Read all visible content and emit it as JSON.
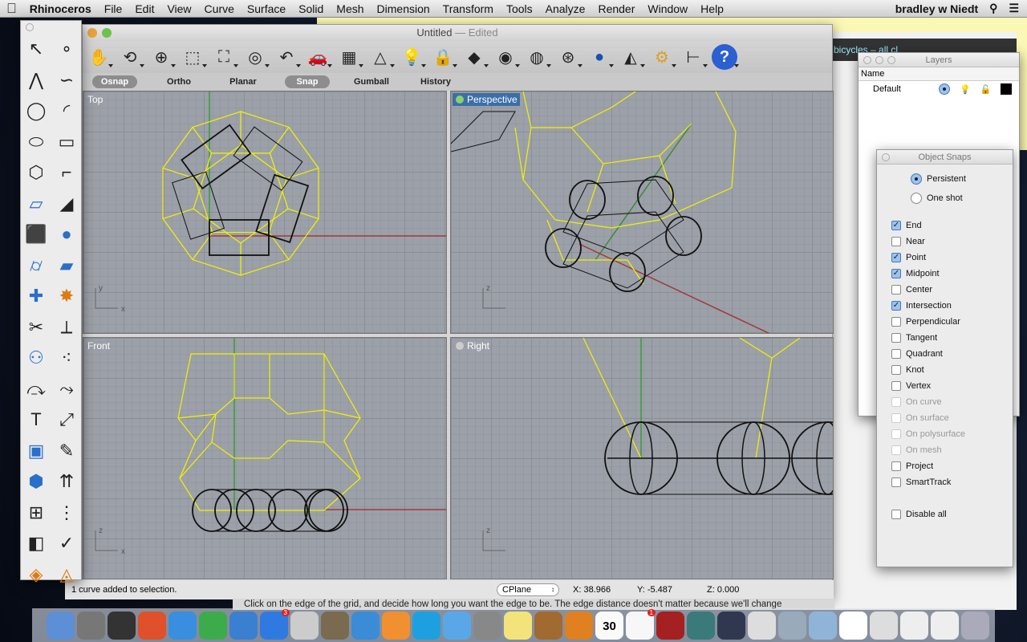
{
  "menubar": {
    "app": "Rhinoceros",
    "items": [
      "File",
      "Edit",
      "View",
      "Curve",
      "Surface",
      "Solid",
      "Mesh",
      "Dimension",
      "Transform",
      "Tools",
      "Analyze",
      "Render",
      "Window",
      "Help"
    ],
    "user": "bradley w Niedt"
  },
  "window": {
    "title": "Untitled",
    "edited": "— Edited"
  },
  "toolbar": [
    "hand-pan-icon",
    "rotate-view-icon",
    "zoom-in-out-icon",
    "zoom-window-icon",
    "zoom-extents-icon",
    "zoom-selected-icon",
    "undo-view-icon",
    "car-named-views-icon",
    "cplane-grid-icon",
    "object-properties-icon",
    "lightbulb-icon",
    "lock-icon",
    "layer-icon",
    "color-wheel-icon",
    "wireframe-sphere-icon",
    "shaded-sphere-grid-icon",
    "rendered-sphere-icon",
    "drafting-icon",
    "gear-icon",
    "dimension-icon",
    "help-icon"
  ],
  "modes": [
    {
      "label": "Osnap",
      "on": true
    },
    {
      "label": "Ortho",
      "on": false
    },
    {
      "label": "Planar",
      "on": false
    },
    {
      "label": "Snap",
      "on": true
    },
    {
      "label": "Gumball",
      "on": false
    },
    {
      "label": "History",
      "on": false
    }
  ],
  "viewports": {
    "top": "Top",
    "perspective": "Perspective",
    "front": "Front",
    "right": "Right"
  },
  "axes": {
    "x": "x",
    "y": "y",
    "z": "z"
  },
  "status": {
    "message": "1 curve added to selection.",
    "cplane": "CPlane",
    "x": "X: 38.966",
    "y": "Y: -5.487",
    "z": "Z: 0.000"
  },
  "toolbox": [
    "select-arrow-icon",
    "point-icon",
    "polyline-icon",
    "curve-icon",
    "circle-icon",
    "arc-icon",
    "ellipse-icon",
    "rectangle-icon",
    "polygon-icon",
    "fillet-icon",
    "surface-from-points-icon",
    "loft-icon",
    "box-icon",
    "sphere-icon",
    "cylinder-icon",
    "surface-icon",
    "boolean-icon",
    "explode-icon",
    "trim-icon",
    "split-icon",
    "boolean-union-icon",
    "points-icon",
    "offset-icon",
    "blend-icon",
    "text-icon",
    "scale-icon",
    "group-icon",
    "edit-points-icon",
    "extrude-icon",
    "array-linear-icon",
    "array-icon",
    "align-icon",
    "cage-icon",
    "check-icon",
    "mesh-icon",
    "dimension-tool-icon"
  ],
  "layers": {
    "title": "Layers",
    "col_name": "Name",
    "rows": [
      {
        "name": "Default",
        "color": "#000000"
      }
    ]
  },
  "osnap": {
    "title": "Object Snaps",
    "modes": [
      {
        "label": "Persistent",
        "on": true
      },
      {
        "label": "One shot",
        "on": false
      }
    ],
    "options": [
      {
        "label": "End",
        "checked": true,
        "enabled": true
      },
      {
        "label": "Near",
        "checked": false,
        "enabled": true
      },
      {
        "label": "Point",
        "checked": true,
        "enabled": true
      },
      {
        "label": "Midpoint",
        "checked": true,
        "enabled": true
      },
      {
        "label": "Center",
        "checked": false,
        "enabled": true
      },
      {
        "label": "Intersection",
        "checked": true,
        "enabled": true
      },
      {
        "label": "Perpendicular",
        "checked": false,
        "enabled": true
      },
      {
        "label": "Tangent",
        "checked": false,
        "enabled": true
      },
      {
        "label": "Quadrant",
        "checked": false,
        "enabled": true
      },
      {
        "label": "Knot",
        "checked": false,
        "enabled": true
      },
      {
        "label": "Vertex",
        "checked": false,
        "enabled": true
      },
      {
        "label": "On curve",
        "checked": false,
        "enabled": false
      },
      {
        "label": "On surface",
        "checked": false,
        "enabled": false
      },
      {
        "label": "On polysurface",
        "checked": false,
        "enabled": false
      },
      {
        "label": "On mesh",
        "checked": false,
        "enabled": false
      },
      {
        "label": "Project",
        "checked": false,
        "enabled": true
      },
      {
        "label": "SmartTrack",
        "checked": false,
        "enabled": true
      }
    ],
    "disable_all": "Disable all"
  },
  "background": {
    "browser_tab": "bicycles – all cl",
    "hint": "Click on the edge of the grid, and decide how long you want the edge to be. The edge distance doesn't matter because we'll change"
  },
  "dock": [
    {
      "name": "finder",
      "color": "#5d8fd6"
    },
    {
      "name": "launchpad",
      "color": "#777"
    },
    {
      "name": "dashboard",
      "color": "#333"
    },
    {
      "name": "app-orange",
      "color": "#e0502a"
    },
    {
      "name": "itunes",
      "color": "#3a8ee0"
    },
    {
      "name": "chrome",
      "color": "#3cab4c"
    },
    {
      "name": "safari",
      "color": "#3a7fd0"
    },
    {
      "name": "app-store",
      "color": "#2f7ae0",
      "badge": "3"
    },
    {
      "name": "rhino",
      "color": "#ccc"
    },
    {
      "name": "xcode",
      "color": "#7a6a50"
    },
    {
      "name": "word",
      "color": "#3a8cd6"
    },
    {
      "name": "pages",
      "color": "#f09030"
    },
    {
      "name": "skype",
      "color": "#1ea0e0"
    },
    {
      "name": "messages",
      "color": "#5aa7e8"
    },
    {
      "name": "system-preferences",
      "color": "#888"
    },
    {
      "name": "stickies",
      "color": "#f3e37a"
    },
    {
      "name": "iphoto",
      "color": "#a06a30"
    },
    {
      "name": "audacity",
      "color": "#e08020"
    },
    {
      "name": "calendar",
      "color": "#fafafa",
      "text": "30"
    },
    {
      "name": "reminders",
      "color": "#f7f7f7",
      "badge": "1"
    },
    {
      "name": "photo-booth",
      "color": "#a52020"
    },
    {
      "name": "time-machine",
      "color": "#3a7a7a"
    },
    {
      "name": "app-dark",
      "color": "#303850"
    },
    {
      "name": "preview",
      "color": "#ddd"
    },
    {
      "name": "iphoto-2",
      "color": "#9ab"
    },
    {
      "name": "folder",
      "color": "#8fb4d8"
    },
    {
      "name": "document",
      "color": "#fff"
    },
    {
      "name": "downloads",
      "color": "#ddd"
    },
    {
      "name": "stack-2",
      "color": "#eee"
    },
    {
      "name": "stack-3",
      "color": "#eee"
    },
    {
      "name": "trash",
      "color": "#aab"
    }
  ]
}
